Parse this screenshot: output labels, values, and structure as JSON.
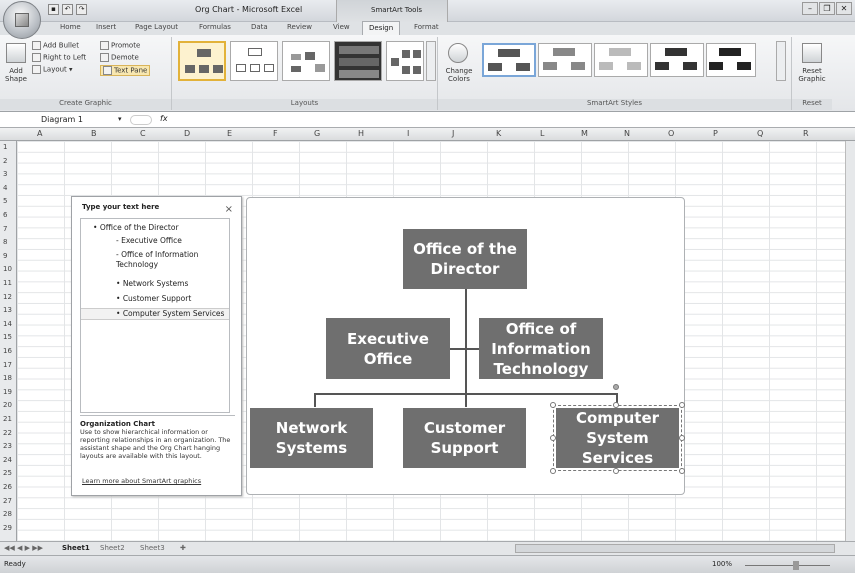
{
  "window": {
    "title": "Org Chart - Microsoft Excel",
    "contextual": "SmartArt Tools"
  },
  "tabs": [
    "Home",
    "Insert",
    "Page Layout",
    "Formulas",
    "Data",
    "Review",
    "View",
    "Design",
    "Format"
  ],
  "ribbon": {
    "create_graphic": {
      "add_shape": "Add Shape",
      "add_bullet": "Add Bullet",
      "right_to_left": "Right to Left",
      "layout": "Layout",
      "promote": "Promote",
      "demote": "Demote",
      "text_pane": "Text Pane",
      "label": "Create Graphic"
    },
    "layouts_label": "Layouts",
    "change_colors": "Change Colors",
    "styles_label": "SmartArt Styles",
    "reset_graphic": "Reset Graphic",
    "reset_label": "Reset"
  },
  "formula": {
    "name_box": "Diagram 1",
    "fx": "fx"
  },
  "columns": [
    "A",
    "B",
    "C",
    "D",
    "E",
    "F",
    "G",
    "H",
    "I",
    "J",
    "K",
    "L",
    "M",
    "N",
    "O",
    "P",
    "Q",
    "R"
  ],
  "rows": [
    "1",
    "2",
    "3",
    "4",
    "5",
    "6",
    "7",
    "8",
    "9",
    "10",
    "11",
    "12",
    "13",
    "14",
    "15",
    "16",
    "17",
    "18",
    "19",
    "20",
    "21",
    "22",
    "23",
    "24",
    "25",
    "26",
    "27",
    "28",
    "29"
  ],
  "text_pane": {
    "title": "Type your text here",
    "close": "×",
    "items": [
      "Office of the Director",
      "Executive Office",
      "Office of Information Technology",
      "Network Systems",
      "Customer Support",
      "Computer System Services"
    ],
    "desc_title": "Organization Chart",
    "desc": "Use to show hierarchical information or reporting relationships in an organization. The assistant shape and the Org Chart hanging layouts are available with this layout.",
    "link": "Learn more about SmartArt graphics"
  },
  "org": {
    "director": "Office of the Director",
    "executive": "Executive Office",
    "it": "Office of Information Technology",
    "network": "Network Systems",
    "support": "Customer Support",
    "services": "Computer System Services"
  },
  "sheets": [
    "Sheet1",
    "Sheet2",
    "Sheet3"
  ],
  "status": {
    "ready": "Ready",
    "zoom": "100%"
  }
}
